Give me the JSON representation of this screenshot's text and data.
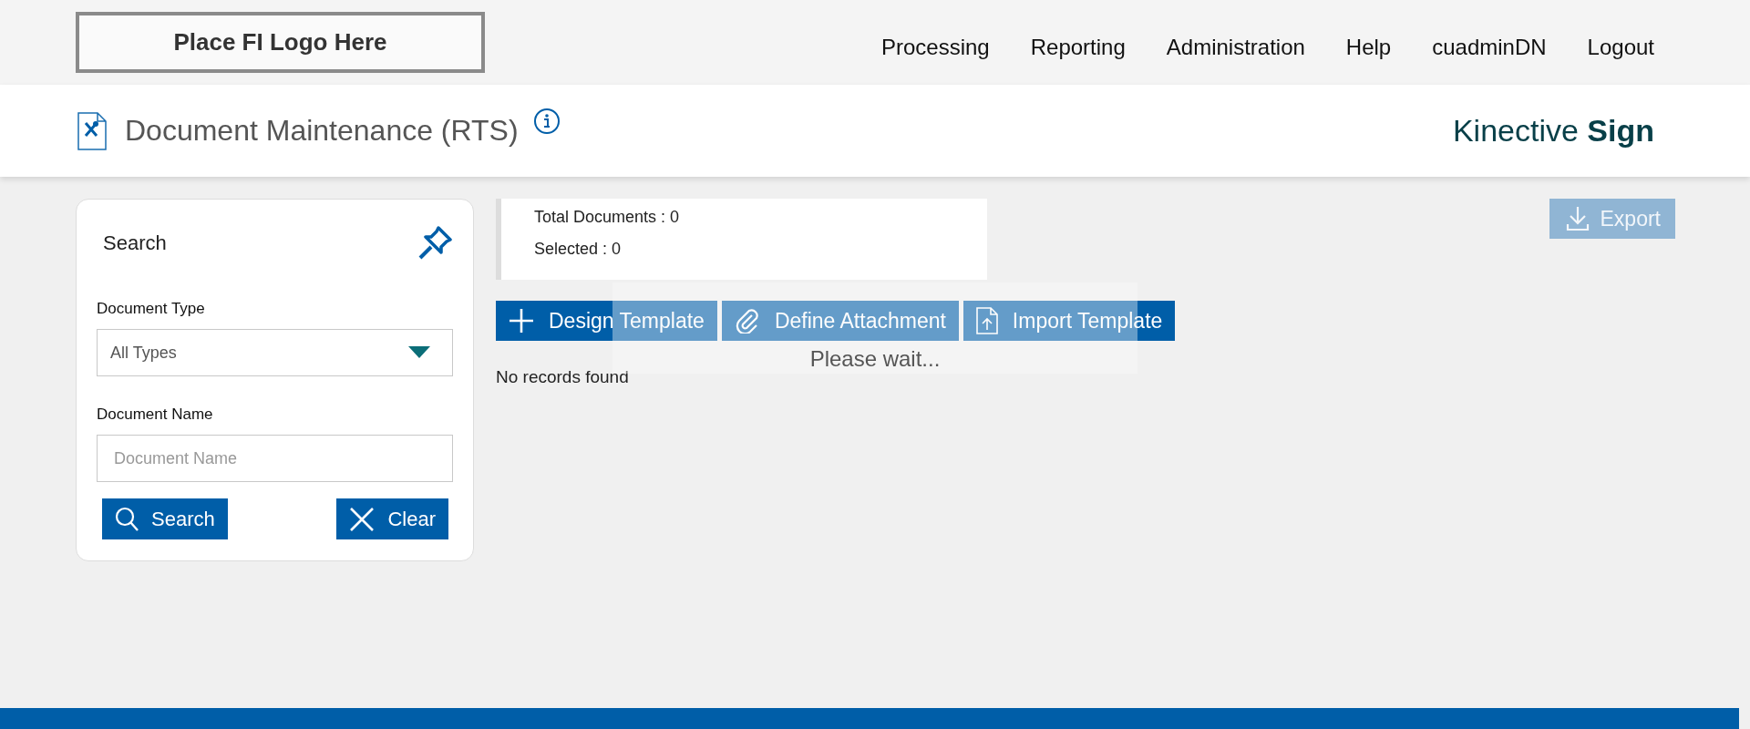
{
  "header": {
    "logo": "Place FI Logo Here",
    "nav": [
      "Processing",
      "Reporting",
      "Administration",
      "Help",
      "cuadminDN",
      "Logout"
    ]
  },
  "page_title": {
    "title": "Document Maintenance (RTS)",
    "brand": "Kinective **Sign**"
  },
  "search_panel": {
    "title": "Search",
    "fields": [
      {
        "kind": "select",
        "label": "Document Type",
        "value": "All Types"
      },
      {
        "kind": "text",
        "label": "Document Name",
        "placeholder": "Document Name"
      }
    ],
    "buttons": [
      {
        "label": "Search"
      },
      {
        "label": "Clear"
      }
    ]
  },
  "summary": [
    "Total Documents : 0",
    "Selected : 0"
  ],
  "actions": [
    {
      "label": "Design Template"
    },
    {
      "label": "Define Attachment"
    },
    {
      "label": "Import Template"
    }
  ],
  "export": {
    "label": "Export",
    "disabled": true
  },
  "empty_message": "No records found",
  "loading": {
    "message": "Please wait..."
  }
}
